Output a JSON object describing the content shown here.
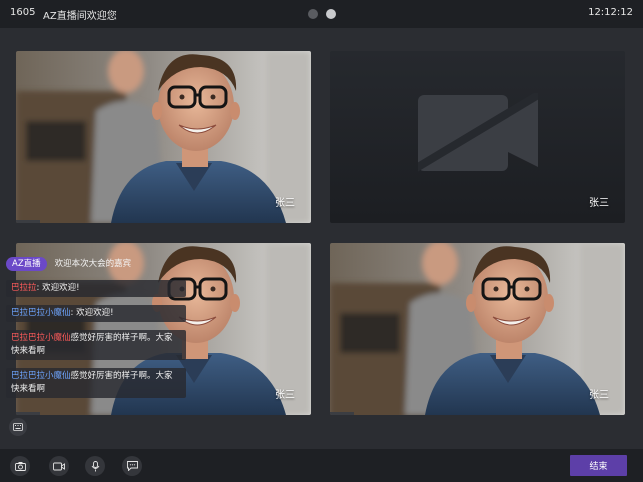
{
  "topbar": {
    "room_id": "1605",
    "room_title": "AZ直播间欢迎您",
    "time": "12:12:12",
    "pages": 2,
    "active_page": 2
  },
  "tiles": [
    {
      "name": "张三",
      "video": true
    },
    {
      "name": "张三",
      "video": false
    },
    {
      "name": "张三",
      "video": true
    },
    {
      "name": "张三",
      "video": true
    }
  ],
  "chat": {
    "badge": "AZ直播",
    "welcome": "欢迎本次大会的嘉宾",
    "messages": [
      {
        "sender": "巴拉拉",
        "text": ": 欢迎欢迎!",
        "color": "#ff5b5b"
      },
      {
        "sender": "巴拉巴拉小魔仙",
        "text": ": 欢迎欢迎!",
        "color": "#6ea5ff"
      },
      {
        "sender": "巴拉巴拉小魔仙",
        "text": "感觉好厉害的样子啊。大家快来看啊",
        "color": "#ff5b5b"
      },
      {
        "sender": "巴拉巴拉小魔仙",
        "text": "感觉好厉害的样子啊。大家快来看啊",
        "color": "#6ea5ff"
      }
    ]
  },
  "toolbar": {
    "icons": [
      "camera-icon",
      "video-icon",
      "microphone-icon",
      "chat-icon"
    ],
    "end_label": "结束"
  },
  "colors": {
    "background": "#2b2d32",
    "bar": "#1e2024",
    "accent": "#5d3fa8",
    "badge": "#6b49c8"
  }
}
